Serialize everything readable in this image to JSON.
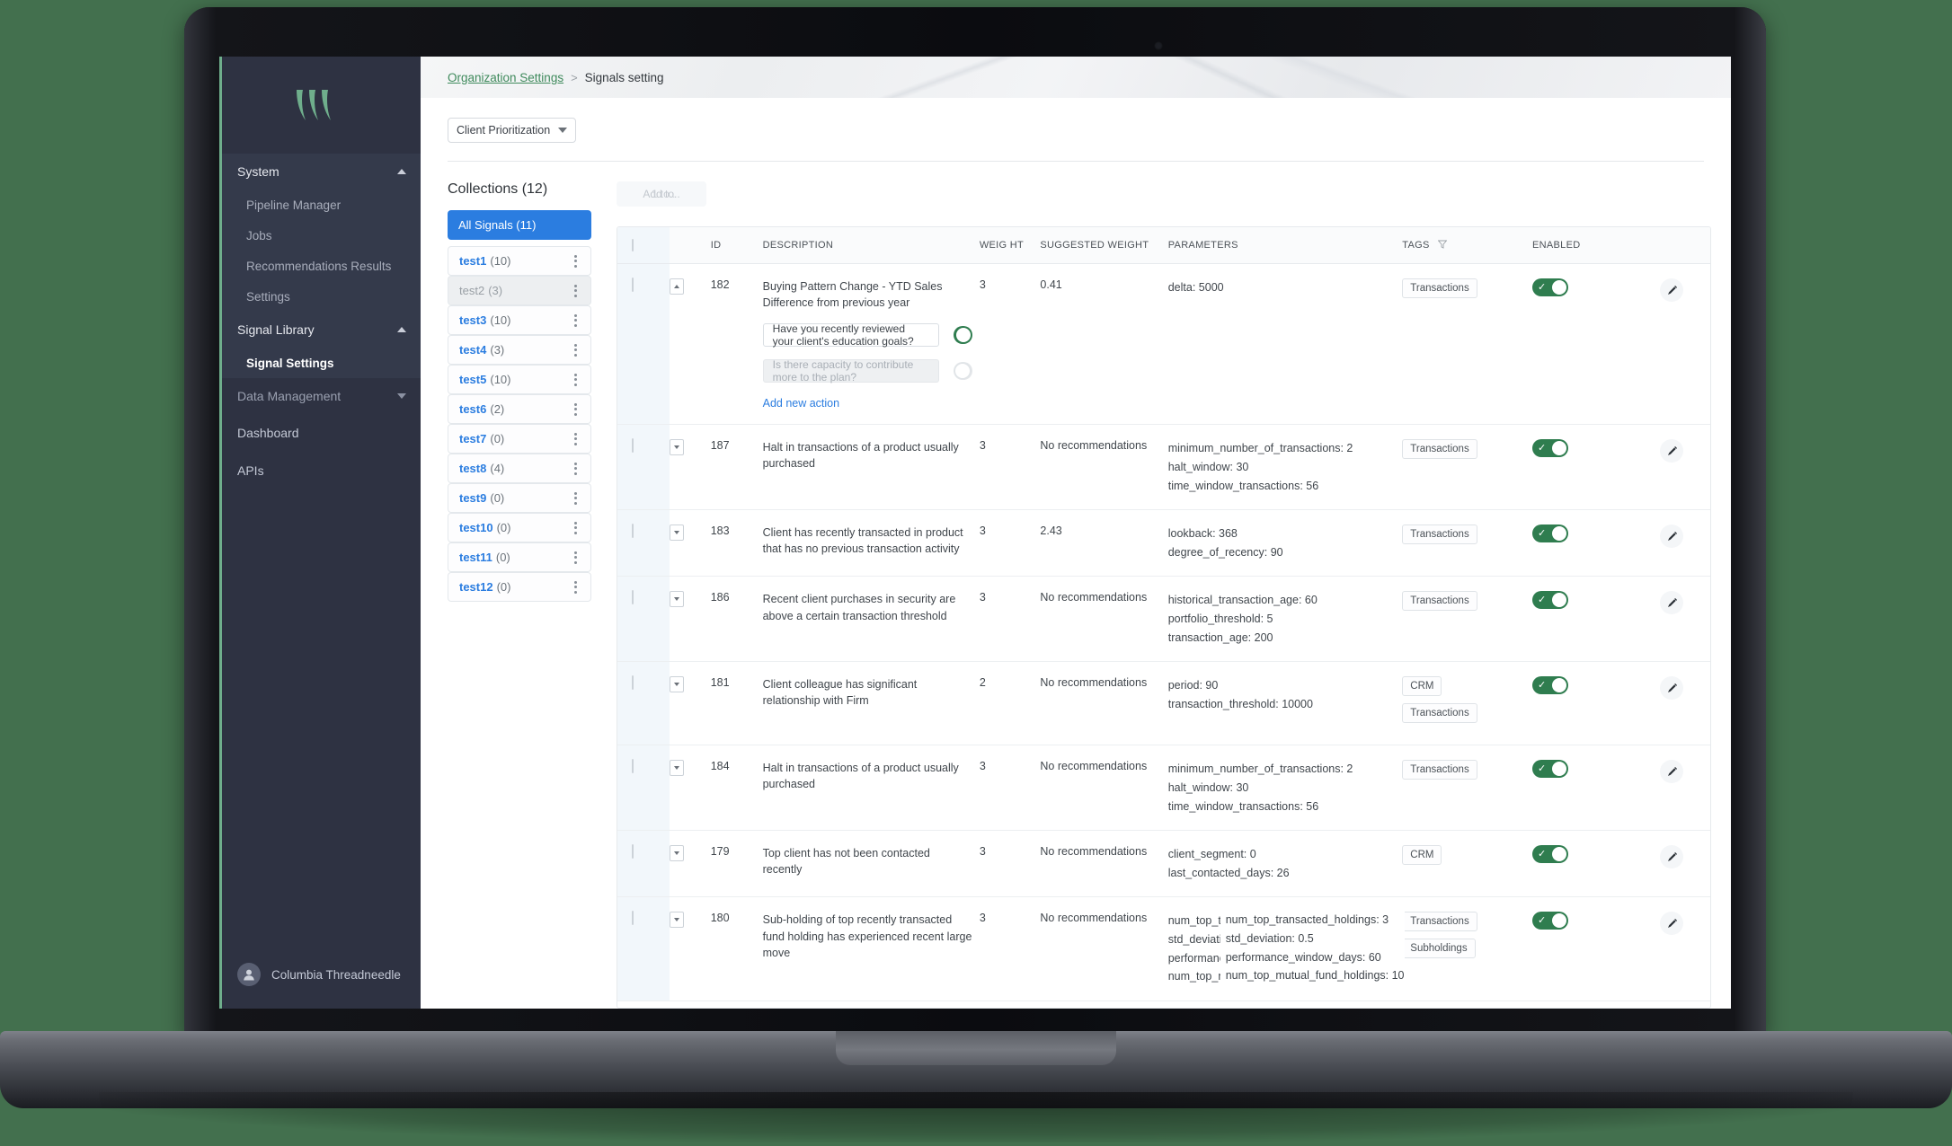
{
  "sidebar": {
    "logo_alt": "brand-logo",
    "groups": [
      {
        "label": "System",
        "expanded": true,
        "items": [
          "Pipeline Manager",
          "Jobs",
          "Recommendations Results",
          "Settings"
        ]
      },
      {
        "label": "Signal Library",
        "expanded": true,
        "items": [
          "Signal Settings"
        ]
      },
      {
        "label": "Data Management",
        "expanded": false,
        "items": []
      }
    ],
    "links": [
      "Dashboard",
      "APIs"
    ],
    "user": "Columbia Threadneedle"
  },
  "breadcrumb": {
    "parent": "Organization Settings",
    "separator": ">",
    "current": "Signals setting"
  },
  "filter": {
    "selected": "Client Prioritization"
  },
  "collections": {
    "title": "Collections (12)",
    "all_label": "All Signals (11)",
    "items": [
      {
        "name": "test1",
        "count": "(10)",
        "muted": false
      },
      {
        "name": "test2",
        "count": "(3)",
        "muted": true
      },
      {
        "name": "test3",
        "count": "(10)",
        "muted": false
      },
      {
        "name": "test4",
        "count": "(3)",
        "muted": false
      },
      {
        "name": "test5",
        "count": "(10)",
        "muted": false
      },
      {
        "name": "test6",
        "count": "(2)",
        "muted": false
      },
      {
        "name": "test7",
        "count": "(0)",
        "muted": false
      },
      {
        "name": "test8",
        "count": "(4)",
        "muted": false
      },
      {
        "name": "test9",
        "count": "(0)",
        "muted": false
      },
      {
        "name": "test10",
        "count": "(0)",
        "muted": false
      },
      {
        "name": "test11",
        "count": "(0)",
        "muted": false
      },
      {
        "name": "test12",
        "count": "(0)",
        "muted": false
      }
    ]
  },
  "toolbar": {
    "add_to_label": "Add to..",
    "add_to_ghost": "1 to.."
  },
  "table": {
    "headers": {
      "id": "ID",
      "description": "DESCRIPTION",
      "weight": "WEIG HT",
      "suggested_weight": "SUGGESTED WEIGHT",
      "parameters": "PARAMETERS",
      "tags": "TAGS",
      "enabled": "ENABLED"
    },
    "rows": [
      {
        "id": "182",
        "description": "Buying Pattern Change - YTD Sales Difference from previous year",
        "weight": "3",
        "suggested_weight": "0.41",
        "parameters": [
          "delta: 5000"
        ],
        "tags": [
          "Transactions"
        ],
        "enabled": true,
        "expanded": true,
        "actions": [
          {
            "text": "Have you recently reviewed your client's education goals?",
            "enabled": true,
            "disabled_field": false
          },
          {
            "text": "Is there capacity to contribute more to the plan?",
            "enabled": false,
            "disabled_field": true
          }
        ],
        "add_action_label": "Add new action"
      },
      {
        "id": "187",
        "description": "Halt in transactions of a product usually purchased",
        "weight": "3",
        "suggested_weight": "No recommendations",
        "parameters": [
          "minimum_number_of_transactions: 2",
          "halt_window: 30",
          "time_window_transactions: 56"
        ],
        "tags": [
          "Transactions"
        ],
        "enabled": true,
        "expanded": false
      },
      {
        "id": "183",
        "description": "Client has recently transacted in product that has no previous transaction activity",
        "weight": "3",
        "suggested_weight": "2.43",
        "parameters": [
          "lookback: 368",
          "degree_of_recency: 90"
        ],
        "tags": [
          "Transactions"
        ],
        "enabled": true,
        "expanded": false
      },
      {
        "id": "186",
        "description": "Recent client purchases in security are above a certain transaction threshold",
        "weight": "3",
        "suggested_weight": "No recommendations",
        "parameters": [
          "historical_transaction_age: 60",
          "portfolio_threshold: 5",
          "transaction_age: 200"
        ],
        "tags": [
          "Transactions"
        ],
        "enabled": true,
        "expanded": false
      },
      {
        "id": "181",
        "description": "Client colleague has significant relationship with Firm",
        "weight": "2",
        "suggested_weight": "No recommendations",
        "parameters": [
          "period: 90",
          "transaction_threshold: 10000"
        ],
        "tags": [
          "CRM",
          "Transactions"
        ],
        "enabled": true,
        "expanded": false
      },
      {
        "id": "184",
        "description": "Halt in transactions of a product usually purchased",
        "weight": "3",
        "suggested_weight": "No recommendations",
        "parameters": [
          "minimum_number_of_transactions: 2",
          "halt_window: 30",
          "time_window_transactions: 56"
        ],
        "tags": [
          "Transactions"
        ],
        "enabled": true,
        "expanded": false
      },
      {
        "id": "179",
        "description": "Top client has not been contacted recently",
        "weight": "3",
        "suggested_weight": "No recommendations",
        "parameters": [
          "client_segment: 0",
          "last_contacted_days: 26"
        ],
        "tags": [
          "CRM"
        ],
        "enabled": true,
        "expanded": false
      },
      {
        "id": "180",
        "description": "Sub-holding of top recently transacted fund holding has experienced recent large move",
        "weight": "3",
        "suggested_weight": "No recommendations",
        "parameters": [
          "num_top_tr",
          "std_deviatio",
          "performanc",
          "num_top_m"
        ],
        "tooltip": [
          "num_top_transacted_holdings: 3",
          "std_deviation: 0.5",
          "performance_window_days: 60",
          "num_top_mutual_fund_holdings: 10"
        ],
        "tags": [
          "Transactions",
          "Subholdings"
        ],
        "enabled": true,
        "expanded": false
      }
    ]
  },
  "colors": {
    "brand_green": "#6fae8c",
    "link_blue": "#2b7de0",
    "toggle_on": "#2f7d4f",
    "sidebar_bg": "#2e3242",
    "page_bg": "#43704e"
  }
}
